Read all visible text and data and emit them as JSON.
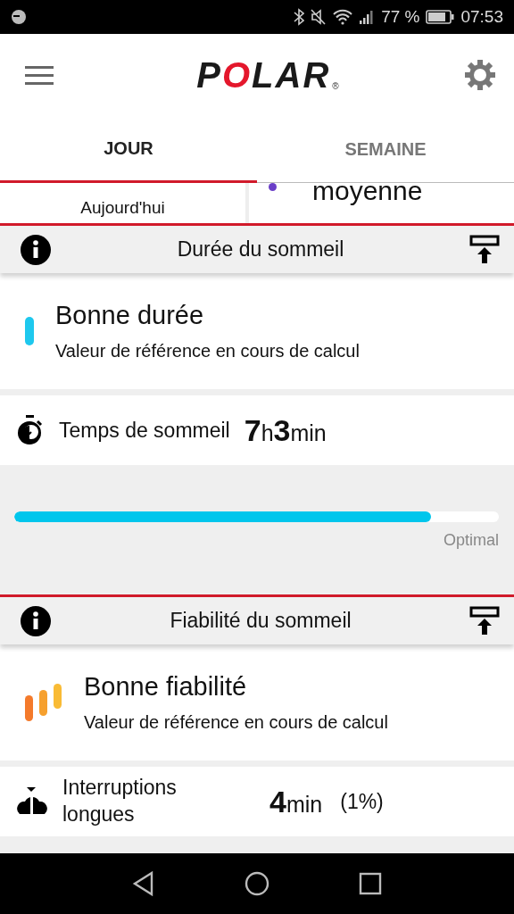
{
  "status_bar": {
    "battery": "77 %",
    "time": "07:53"
  },
  "header": {
    "logo": "POLAR",
    "registered": "®"
  },
  "tabs": [
    {
      "label": "JOUR",
      "selected": true
    },
    {
      "label": "SEMAINE",
      "selected": false
    }
  ],
  "summary_cards": [
    {
      "label": "Aujourd'hui"
    },
    {
      "label": "moyenne",
      "color": "#6a3fc8"
    }
  ],
  "sections": [
    {
      "title": "Durée du sommeil",
      "rating": {
        "kind": "bar",
        "title": "Bonne durée",
        "subtitle": "Valeur de référence en cours de calcul"
      },
      "metric": {
        "kind": "stopwatch",
        "label": "Temps de sommeil",
        "value": [
          {
            "num": "7",
            "unit": "h"
          },
          {
            "num": "3",
            "unit": "min"
          }
        ]
      },
      "progress": {
        "level": 0.86,
        "label": "Optimal"
      }
    },
    {
      "title": "Fiabilité du sommeil",
      "rating": {
        "kind": "bars",
        "title": "Bonne fiabilité",
        "subtitle": "Valeur de référence en cours de calcul"
      },
      "metric": {
        "kind": "interruptions",
        "label": "Interruptions longues",
        "value": [
          {
            "num": "4",
            "unit": "min"
          }
        ],
        "extra": "(1%)"
      }
    }
  ]
}
